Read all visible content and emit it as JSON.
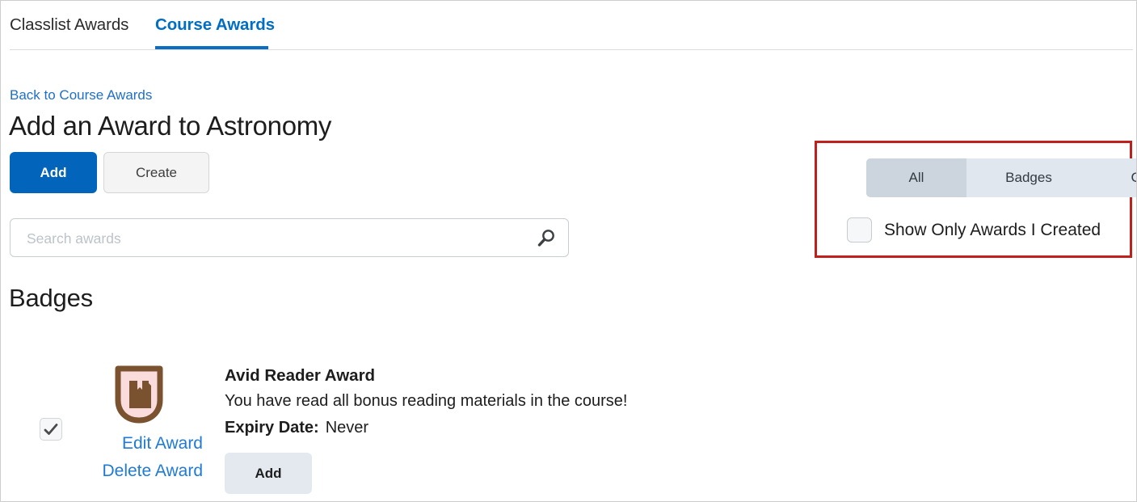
{
  "tabs": [
    {
      "label": "Classlist Awards",
      "active": false
    },
    {
      "label": "Course Awards",
      "active": true
    }
  ],
  "header": {
    "back_link": "Back to Course Awards",
    "title": "Add an Award to Astronomy",
    "add_label": "Add",
    "create_label": "Create"
  },
  "search": {
    "placeholder": "Search awards",
    "value": "",
    "icon": "search-icon"
  },
  "filters": {
    "segments": [
      {
        "label": "All",
        "selected": true
      },
      {
        "label": "Badges",
        "selected": false
      },
      {
        "label": "Certificates",
        "selected": false
      }
    ],
    "show_only_created_label": "Show Only Awards I Created",
    "show_only_created_checked": false,
    "highlight_color": "#c0201c"
  },
  "section": {
    "title": "Badges"
  },
  "award": {
    "selected": true,
    "icon": "book-badge-icon",
    "name": "Avid Reader Award",
    "description": "You have read all bonus reading materials in the course!",
    "expiry_label": "Expiry Date:",
    "expiry_value": "Never",
    "edit_link": "Edit Award",
    "delete_link": "Delete Award",
    "add_label": "Add"
  },
  "colors": {
    "primary_blue": "#0265bb",
    "link_blue": "#1f7ad4",
    "tab_active_blue": "#006ec2",
    "segment_selected": "#ccd5de",
    "segment_base": "#e1e7ee",
    "badge_brown": "#7b5230",
    "badge_pink": "#fadcdc"
  }
}
